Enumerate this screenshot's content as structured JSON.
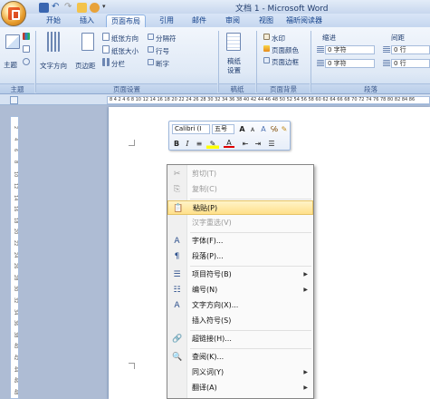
{
  "window": {
    "title": "文档 1 - Microsoft Word"
  },
  "ribbon_tabs": [
    "开始",
    "插入",
    "页面布局",
    "引用",
    "邮件",
    "审阅",
    "视图",
    "福昕阅读器"
  ],
  "active_tab": "页面布局",
  "ribbon": {
    "theme": {
      "label": "主题",
      "group": "主题"
    },
    "page_setup": {
      "group": "页面设置",
      "text_direction": "文字方向",
      "margins": "页边距",
      "orientation": "纸张方向",
      "size": "纸张大小",
      "columns": "分栏",
      "breaks": "分隔符",
      "line_numbers": "行号",
      "hyphenation": "断字"
    },
    "manuscript": {
      "label": "稿纸\n设置",
      "group": "稿纸"
    },
    "page_background": {
      "group": "页面背景",
      "watermark": "水印",
      "page_color": "页面颜色",
      "page_borders": "页面边框"
    },
    "paragraph": {
      "group": "段落",
      "indent": "缩进",
      "spacing": "间距",
      "indent_left": "0 字符",
      "indent_right": "0 字符",
      "spacing_before": "0 行",
      "spacing_after": "0 行"
    }
  },
  "ruler_text": "8 4   2  4  6  8 10 12 14 16 18 20 22 24 26 28 30 32 34 36 38 40 42 44 46 48 50 52 54 56 58 60 62 64 66 68 70 72 74 76 78 80 82 84 86",
  "vruler_ticks": [
    "2",
    "4",
    "6",
    "8",
    "10",
    "12",
    "14",
    "16",
    "18",
    "20",
    "22",
    "24",
    "26",
    "28",
    "30",
    "32",
    "34",
    "36",
    "38",
    "40",
    "42",
    "44",
    "46",
    "48"
  ],
  "mini_toolbar": {
    "font": "Calibri (I",
    "size": "五号",
    "grow": "A",
    "shrink": "A",
    "bold": "B",
    "italic": "I"
  },
  "context_menu": [
    {
      "label": "剪切(T)",
      "icon": "✂",
      "disabled": true
    },
    {
      "label": "复制(C)",
      "icon": "⎘",
      "disabled": true
    },
    {
      "label": "粘贴(P)",
      "icon": "📋",
      "highlight": true
    },
    {
      "label": "汉字重选(V)",
      "icon": "",
      "disabled": true
    },
    {
      "label": "字体(F)...",
      "icon": "A"
    },
    {
      "label": "段落(P)...",
      "icon": "¶"
    },
    {
      "label": "项目符号(B)",
      "icon": "☰",
      "submenu": true
    },
    {
      "label": "编号(N)",
      "icon": "☷",
      "submenu": true
    },
    {
      "label": "文字方向(X)...",
      "icon": "A"
    },
    {
      "label": "插入符号(S)",
      "icon": ""
    },
    {
      "label": "超链接(H)...",
      "icon": "🔗"
    },
    {
      "label": "查阅(K)...",
      "icon": "🔍"
    },
    {
      "label": "同义词(Y)",
      "icon": "",
      "submenu": true
    },
    {
      "label": "翻译(A)",
      "icon": "",
      "submenu": true
    }
  ],
  "colors": {
    "highlight": "#ffe08a",
    "ribbon_bg": "#dfe9f6",
    "accent": "#15428b"
  }
}
